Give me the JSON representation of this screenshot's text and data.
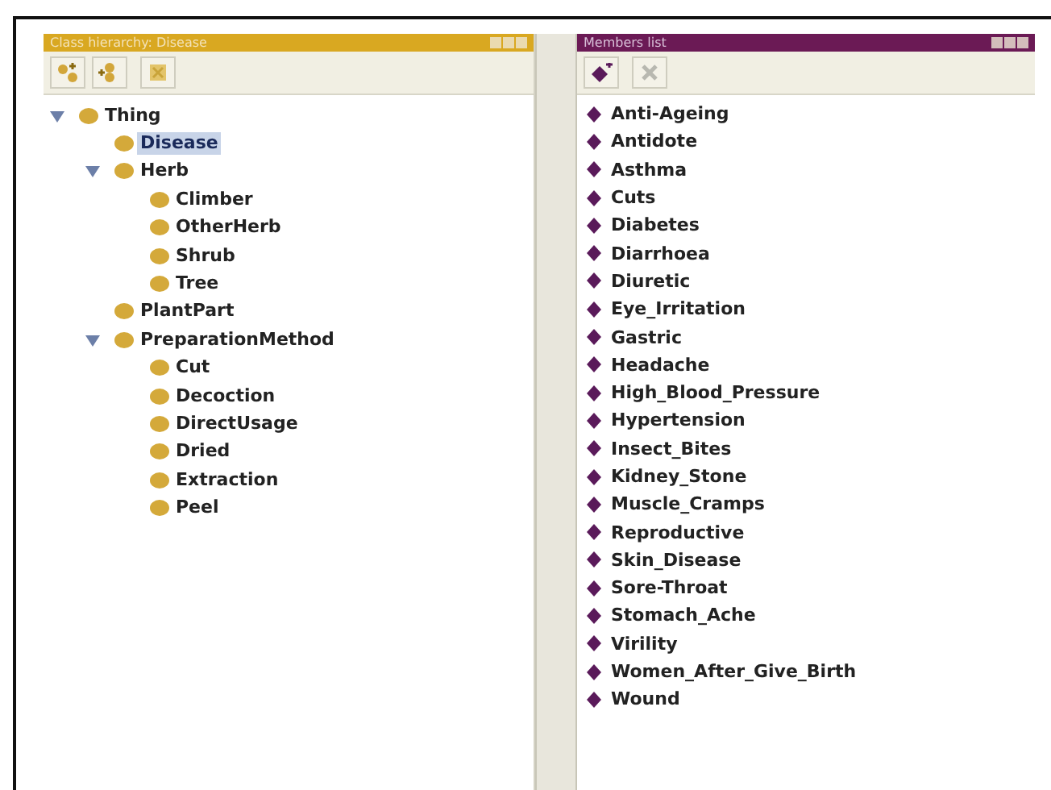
{
  "class_panel": {
    "title": "Class hierarchy: Disease",
    "tree": [
      {
        "label": "Thing",
        "expanded": true,
        "selected": false,
        "children": [
          {
            "label": "Disease",
            "selected": true
          },
          {
            "label": "Herb",
            "expanded": true,
            "selected": false,
            "children": [
              {
                "label": "Climber",
                "selected": false
              },
              {
                "label": "OtherHerb",
                "selected": false
              },
              {
                "label": "Shrub",
                "selected": false
              },
              {
                "label": "Tree",
                "selected": false
              }
            ]
          },
          {
            "label": "PlantPart",
            "selected": false
          },
          {
            "label": "PreparationMethod",
            "expanded": true,
            "selected": false,
            "children": [
              {
                "label": "Cut",
                "selected": false
              },
              {
                "label": "Decoction",
                "selected": false
              },
              {
                "label": "DirectUsage",
                "selected": false
              },
              {
                "label": "Dried",
                "selected": false
              },
              {
                "label": "Extraction",
                "selected": false
              },
              {
                "label": "Peel",
                "selected": false
              }
            ]
          }
        ]
      }
    ]
  },
  "members_panel": {
    "title": "Members list",
    "members": [
      "Anti-Ageing",
      "Antidote",
      "Asthma",
      "Cuts",
      "Diabetes",
      "Diarrhoea",
      "Diuretic",
      "Eye_Irritation",
      "Gastric",
      "Headache",
      "High_Blood_Pressure",
      "Hypertension",
      "Insect_Bites",
      "Kidney_Stone",
      "Muscle_Cramps",
      "Reproductive",
      "Skin_Disease",
      "Sore-Throat",
      "Stomach_Ache",
      "Virility",
      "Women_After_Give_Birth",
      "Wound"
    ]
  }
}
